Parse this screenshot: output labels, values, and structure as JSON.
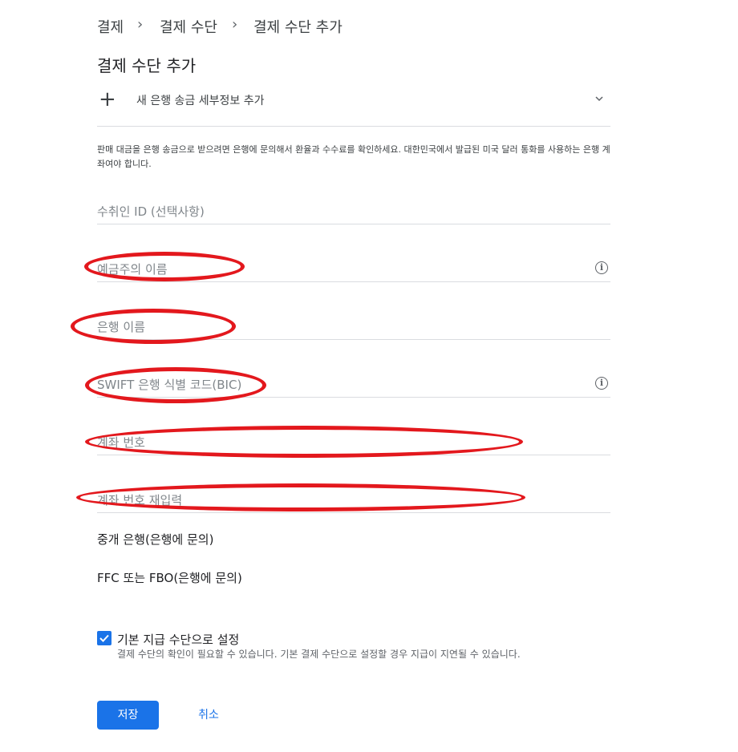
{
  "breadcrumb": {
    "items": [
      "결제",
      "결제 수단",
      "결제 수단 추가"
    ]
  },
  "page_title": "결제 수단 추가",
  "add_section": {
    "label": "새 은행 송금 세부정보 추가",
    "icons": {
      "add": "plus-icon",
      "expand": "chevron-down-icon"
    }
  },
  "note": "판매 대금을 은행 송금으로 받으려면 은행에 문의해서 환율과 수수료를 확인하세요. 대한민국에서 발급된 미국 달러 통화를 사용하는 은행 계좌여야 합니다.",
  "fields": {
    "payee_id": "수취인 ID (선택사항)",
    "account_holder": "예금주의 이름",
    "bank_name": "은행 이름",
    "swift_code": "SWIFT 은행 식별 코드(BIC)",
    "account_number": "계좌 번호",
    "account_number_confirm": "계좌 번호 재입력"
  },
  "expandables": {
    "intermediary_bank": "중개 은행(은행에 문의)",
    "ffc_fbo": "FFC 또는 FBO(은행에 문의)"
  },
  "default_payment": {
    "checked": true,
    "label": "기본 지급 수단으로 설정",
    "help": "결제 수단의 확인이 필요할 수 있습니다. 기본 결제 수단으로 설정할 경우 지급이 지연될 수 있습니다."
  },
  "buttons": {
    "save": "저장",
    "cancel": "취소"
  },
  "colors": {
    "accent": "#1a73e8",
    "annotation": "#e3181d",
    "divider": "#dadce0"
  }
}
